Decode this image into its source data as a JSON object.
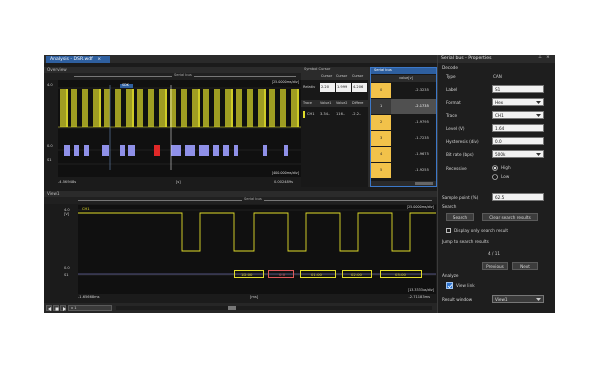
{
  "window": {
    "tab_title": "Analysis - DSR.wdf",
    "tab_close": "×"
  },
  "overview": {
    "title": "Overview",
    "serial_bus_label": "Serial bus",
    "left_time": "-4.5K948s",
    "center_time": "[s]",
    "right_time": "0.002489s",
    "marker_label": "SDK",
    "y_labels": [
      "4.0",
      "0.0",
      "S1"
    ],
    "top_right_readout": "[25.0000ms/div]",
    "bottom_right_readout": "[400.000ms/div]"
  },
  "symbol_cursor": {
    "title": "Symbol Cursor",
    "header_cells": [
      "Cursor",
      "Cursor",
      "Cursor"
    ],
    "row_label": "Relativ",
    "row_values": [
      "2.20",
      "1.999",
      "4.206"
    ],
    "col_headers": [
      "Trace",
      "Value1",
      "Value2",
      "Differe"
    ],
    "trace_row": [
      "CH1",
      "3.34..",
      "116..",
      "-2.2.."
    ]
  },
  "serial_bus_list": {
    "title": "Serial bus",
    "column_header": "value[v]",
    "rows": [
      {
        "index": "0",
        "value": "-2.3235"
      },
      {
        "index": "1",
        "value": "-2.1735"
      },
      {
        "index": "2",
        "value": "-1.9795"
      },
      {
        "index": "3",
        "value": "-1.7235"
      },
      {
        "index": "4",
        "value": "-1.9675"
      },
      {
        "index": "5",
        "value": "-1.9255"
      }
    ]
  },
  "view1": {
    "title": "View1",
    "serial_bus_label": "Serial bus",
    "channel_label": "CH1",
    "top_right_readout": "[25.0000ms/div]",
    "bottom_right_readout": "[13.3333us/div]",
    "left_time": "-1.65668ms",
    "center_time": "[ms]",
    "right_time": "-2.71183ms",
    "y_labels": [
      "4.0",
      "[V]",
      "0.0",
      "S1"
    ],
    "decode_boxes": [
      "1D:00",
      "0:0",
      "01:00",
      "02:00",
      "03:00"
    ]
  },
  "bottom_toolbar": {
    "zoom_value": "x 1"
  },
  "properties": {
    "title": "Serial bus - Properties",
    "pin_icon": "⊥",
    "close_icon": "×",
    "section_decode": "Decode",
    "type_label": "Type",
    "type_value": "CAN",
    "label_label": "Label",
    "label_value": "S1",
    "format_label": "Format",
    "format_value": "Hex",
    "trace_label": "Trace",
    "trace_value": "CH1",
    "level_label": "Level (V)",
    "level_value": "1.64",
    "hysteresis_label": "Hysteresis (div)",
    "hysteresis_value": "0.0",
    "bitrate_label": "Bit rate (bps)",
    "bitrate_value": "500k",
    "recessive_label": "Recessive",
    "recessive_high": "High",
    "recessive_low": "Low",
    "sample_point_label": "Sample point (%)",
    "sample_point_value": "62.5",
    "search_label": "Search",
    "search_button": "Search",
    "clear_button": "Clear search results",
    "display_only_label": "Display only search result",
    "jump_label": "Jump to search results",
    "counter": "4 / 11",
    "previous_button": "Previous",
    "next_button": "Next",
    "analyze_label": "Analyze",
    "view_link_label": "View link",
    "result_window_label": "Result window",
    "result_window_value": "View1"
  },
  "colors": {
    "signal_yellow": "#e0dc2a",
    "decode_blue": "#8f90e8",
    "decode_red": "#e02828",
    "accent_blue": "#2e5f9f",
    "highlight_orange": "#f2c24a"
  }
}
